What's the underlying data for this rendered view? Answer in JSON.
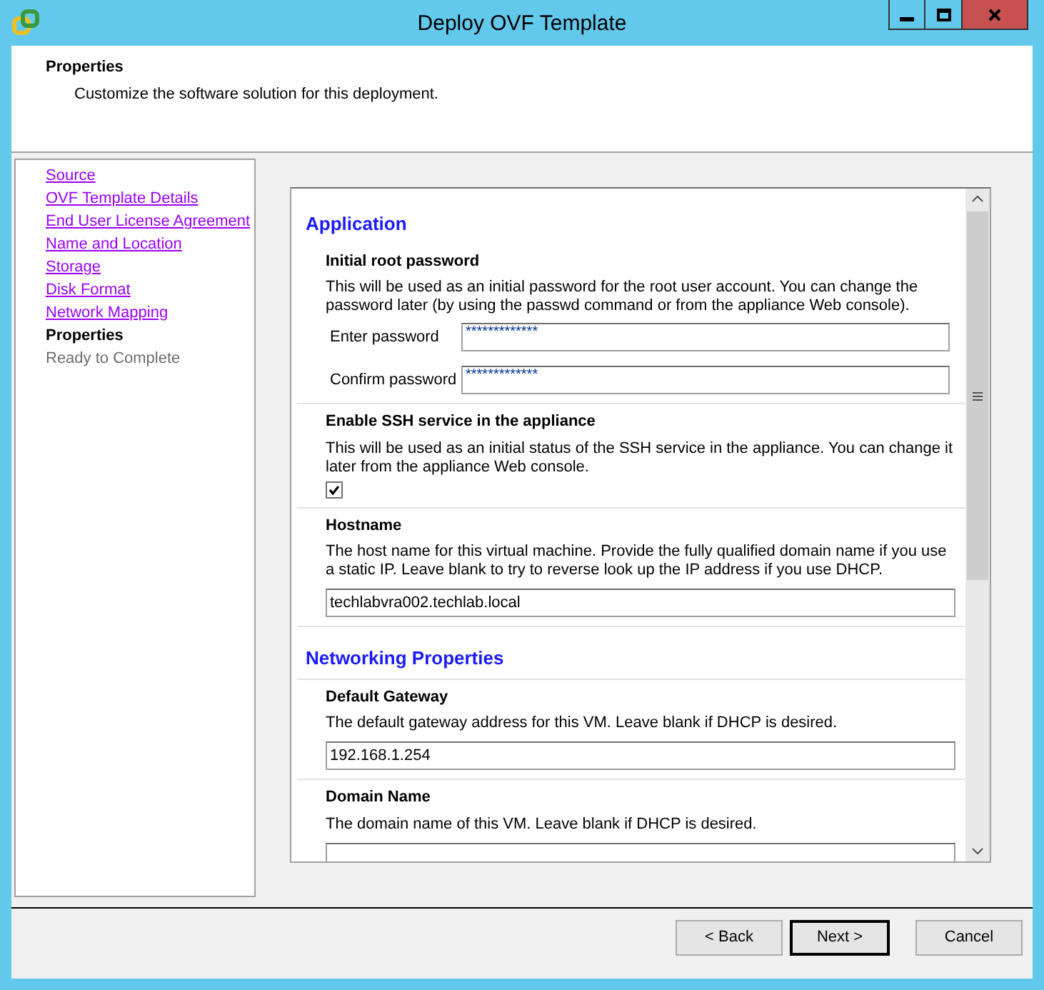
{
  "window": {
    "title": "Deploy OVF Template"
  },
  "header": {
    "title": "Properties",
    "subtitle": "Customize the software solution for this deployment."
  },
  "steps": [
    {
      "label": "Source",
      "selected": false,
      "disabled": false
    },
    {
      "label": "OVF Template Details",
      "selected": false,
      "disabled": false
    },
    {
      "label": "End User License Agreement",
      "selected": false,
      "disabled": false
    },
    {
      "label": "Name and Location",
      "selected": false,
      "disabled": false
    },
    {
      "label": "Storage",
      "selected": false,
      "disabled": false
    },
    {
      "label": "Disk Format",
      "selected": false,
      "disabled": false
    },
    {
      "label": "Network Mapping",
      "selected": false,
      "disabled": false
    },
    {
      "label": "Properties",
      "selected": true,
      "disabled": false
    },
    {
      "label": "Ready to Complete",
      "selected": false,
      "disabled": true
    }
  ],
  "sections": [
    {
      "heading": "Application",
      "properties": [
        {
          "kind": "passwords",
          "title": "Initial root password",
          "description": "This will be used as an initial password for the root user account. You can change the password later (by using the passwd command or from the appliance Web console).",
          "inputs": [
            {
              "label": "Enter password",
              "value": "*************"
            },
            {
              "label": "Confirm password",
              "value": "*************"
            }
          ]
        },
        {
          "kind": "checkbox",
          "title": "Enable SSH service in the appliance",
          "description": "This will be used as an initial status of the SSH service in the appliance. You can change it later from the appliance Web console.",
          "checked": true
        },
        {
          "kind": "text",
          "title": "Hostname",
          "description": "The host name for this virtual machine. Provide the fully qualified domain name if you use a static IP. Leave blank to try to reverse look up the IP address if you use DHCP.",
          "value": "techlabvra002.techlab.local"
        }
      ]
    },
    {
      "heading": "Networking Properties",
      "properties": [
        {
          "kind": "text",
          "title": "Default Gateway",
          "description": "The default gateway address for this VM. Leave blank if DHCP is desired.",
          "value": "192.168.1.254"
        },
        {
          "kind": "text",
          "title": "Domain Name",
          "description": "The domain name of this VM. Leave blank if DHCP is desired."
        }
      ]
    }
  ],
  "buttons": [
    {
      "label": "< Back",
      "default": false
    },
    {
      "label": "Next >",
      "default": true
    },
    {
      "label": "Cancel",
      "default": false
    }
  ]
}
